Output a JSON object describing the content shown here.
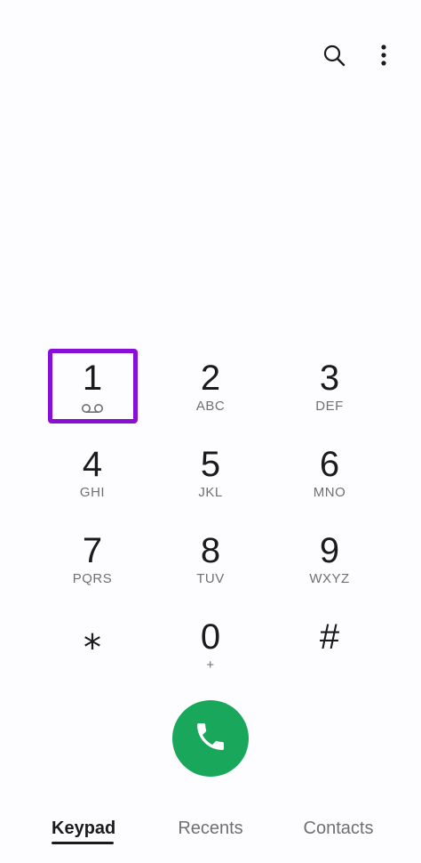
{
  "header": {
    "search_icon": "search-icon",
    "more_icon": "more-vertical-icon"
  },
  "keypad": {
    "keys": [
      {
        "digit": "1",
        "letters": "",
        "icon": "voicemail-icon"
      },
      {
        "digit": "2",
        "letters": "ABC"
      },
      {
        "digit": "3",
        "letters": "DEF"
      },
      {
        "digit": "4",
        "letters": "GHI"
      },
      {
        "digit": "5",
        "letters": "JKL"
      },
      {
        "digit": "6",
        "letters": "MNO"
      },
      {
        "digit": "7",
        "letters": "PQRS"
      },
      {
        "digit": "8",
        "letters": "TUV"
      },
      {
        "digit": "9",
        "letters": "WXYZ"
      },
      {
        "digit": "⁎",
        "letters": ""
      },
      {
        "digit": "0",
        "letters": "+"
      },
      {
        "digit": "#",
        "letters": ""
      }
    ],
    "highlight_color": "#8a0fd6"
  },
  "call": {
    "icon": "phone-icon",
    "color": "#19a85b"
  },
  "tabs": [
    {
      "label": "Keypad",
      "active": true
    },
    {
      "label": "Recents",
      "active": false
    },
    {
      "label": "Contacts",
      "active": false
    }
  ]
}
